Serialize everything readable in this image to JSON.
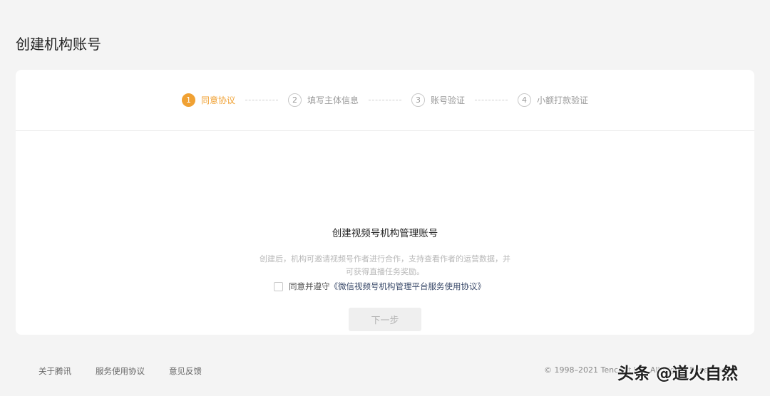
{
  "page": {
    "title": "创建机构账号"
  },
  "steps": [
    {
      "num": "1",
      "label": "同意协议",
      "active": true
    },
    {
      "num": "2",
      "label": "填写主体信息",
      "active": false
    },
    {
      "num": "3",
      "label": "账号验证",
      "active": false
    },
    {
      "num": "4",
      "label": "小额打款验证",
      "active": false
    }
  ],
  "main": {
    "heading": "创建视频号机构管理账号",
    "description": "创建后，机构可邀请视频号作者进行合作，支持查看作者的运营数据，并可获得直播任务奖励。",
    "agree_prefix": "同意并遵守",
    "agree_link": "《微信视频号机构管理平台服务使用协议》",
    "agree_checked": false,
    "next_button": "下一步"
  },
  "footer": {
    "links": [
      "关于腾讯",
      "服务使用协议",
      "意见反馈"
    ],
    "copyright": "© 1998–2021 Tencent Inc. All Rights Reserved"
  },
  "watermark": "头条 @道火自然",
  "colors": {
    "accent": "#f0a133",
    "background": "#f4f4f4",
    "card": "#ffffff"
  }
}
